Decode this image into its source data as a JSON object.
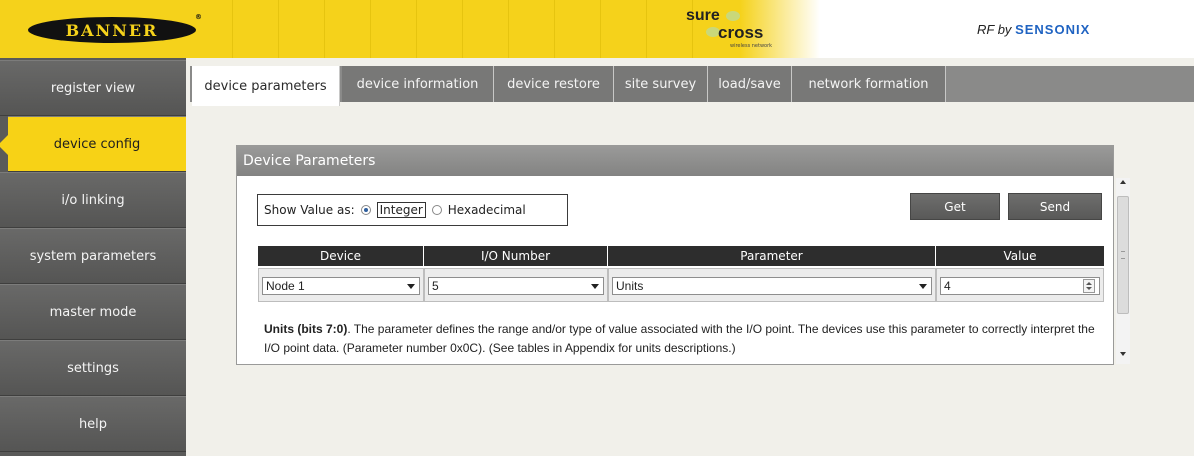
{
  "header": {
    "brand": "BANNER",
    "brand_reg": "®",
    "product_sure": "sure",
    "product_cross": "cross",
    "product_tag": "wireless network",
    "rf_by": "RF by",
    "partner": "SENSONIX",
    "accent_color": "#f5d21b",
    "partner_color": "#1f63c2"
  },
  "sidebar": {
    "items": [
      {
        "label": "register view",
        "active": false
      },
      {
        "label": "device config",
        "active": true
      },
      {
        "label": "i/o linking",
        "active": false
      },
      {
        "label": "system parameters",
        "active": false
      },
      {
        "label": "master mode",
        "active": false
      },
      {
        "label": "settings",
        "active": false
      },
      {
        "label": "help",
        "active": false
      }
    ],
    "active_color": "#f7d216"
  },
  "tabs": [
    {
      "label": "device parameters",
      "active": true
    },
    {
      "label": "device information",
      "active": false
    },
    {
      "label": "device restore",
      "active": false
    },
    {
      "label": "site survey",
      "active": false
    },
    {
      "label": "load/save",
      "active": false
    },
    {
      "label": "network formation",
      "active": false
    }
  ],
  "panel": {
    "title": "Device Parameters",
    "show_value_label": "Show Value as:",
    "radio_integer": "Integer",
    "radio_hex": "Hexadecimal",
    "selected_format": "Integer",
    "get_label": "Get",
    "send_label": "Send",
    "columns": [
      "Device",
      "I/O Number",
      "Parameter",
      "Value"
    ],
    "device_value": "Node 1",
    "io_number_value": "5",
    "parameter_value": "Units",
    "value_value": "4",
    "desc_bold": "Units (bits 7:0)",
    "desc_text": ". The parameter defines the range and/or type of value associated with the I/O point. The devices use this parameter to correctly interpret the I/O point data. (Parameter number 0x0C). (See tables in Appendix for units descriptions.)"
  }
}
